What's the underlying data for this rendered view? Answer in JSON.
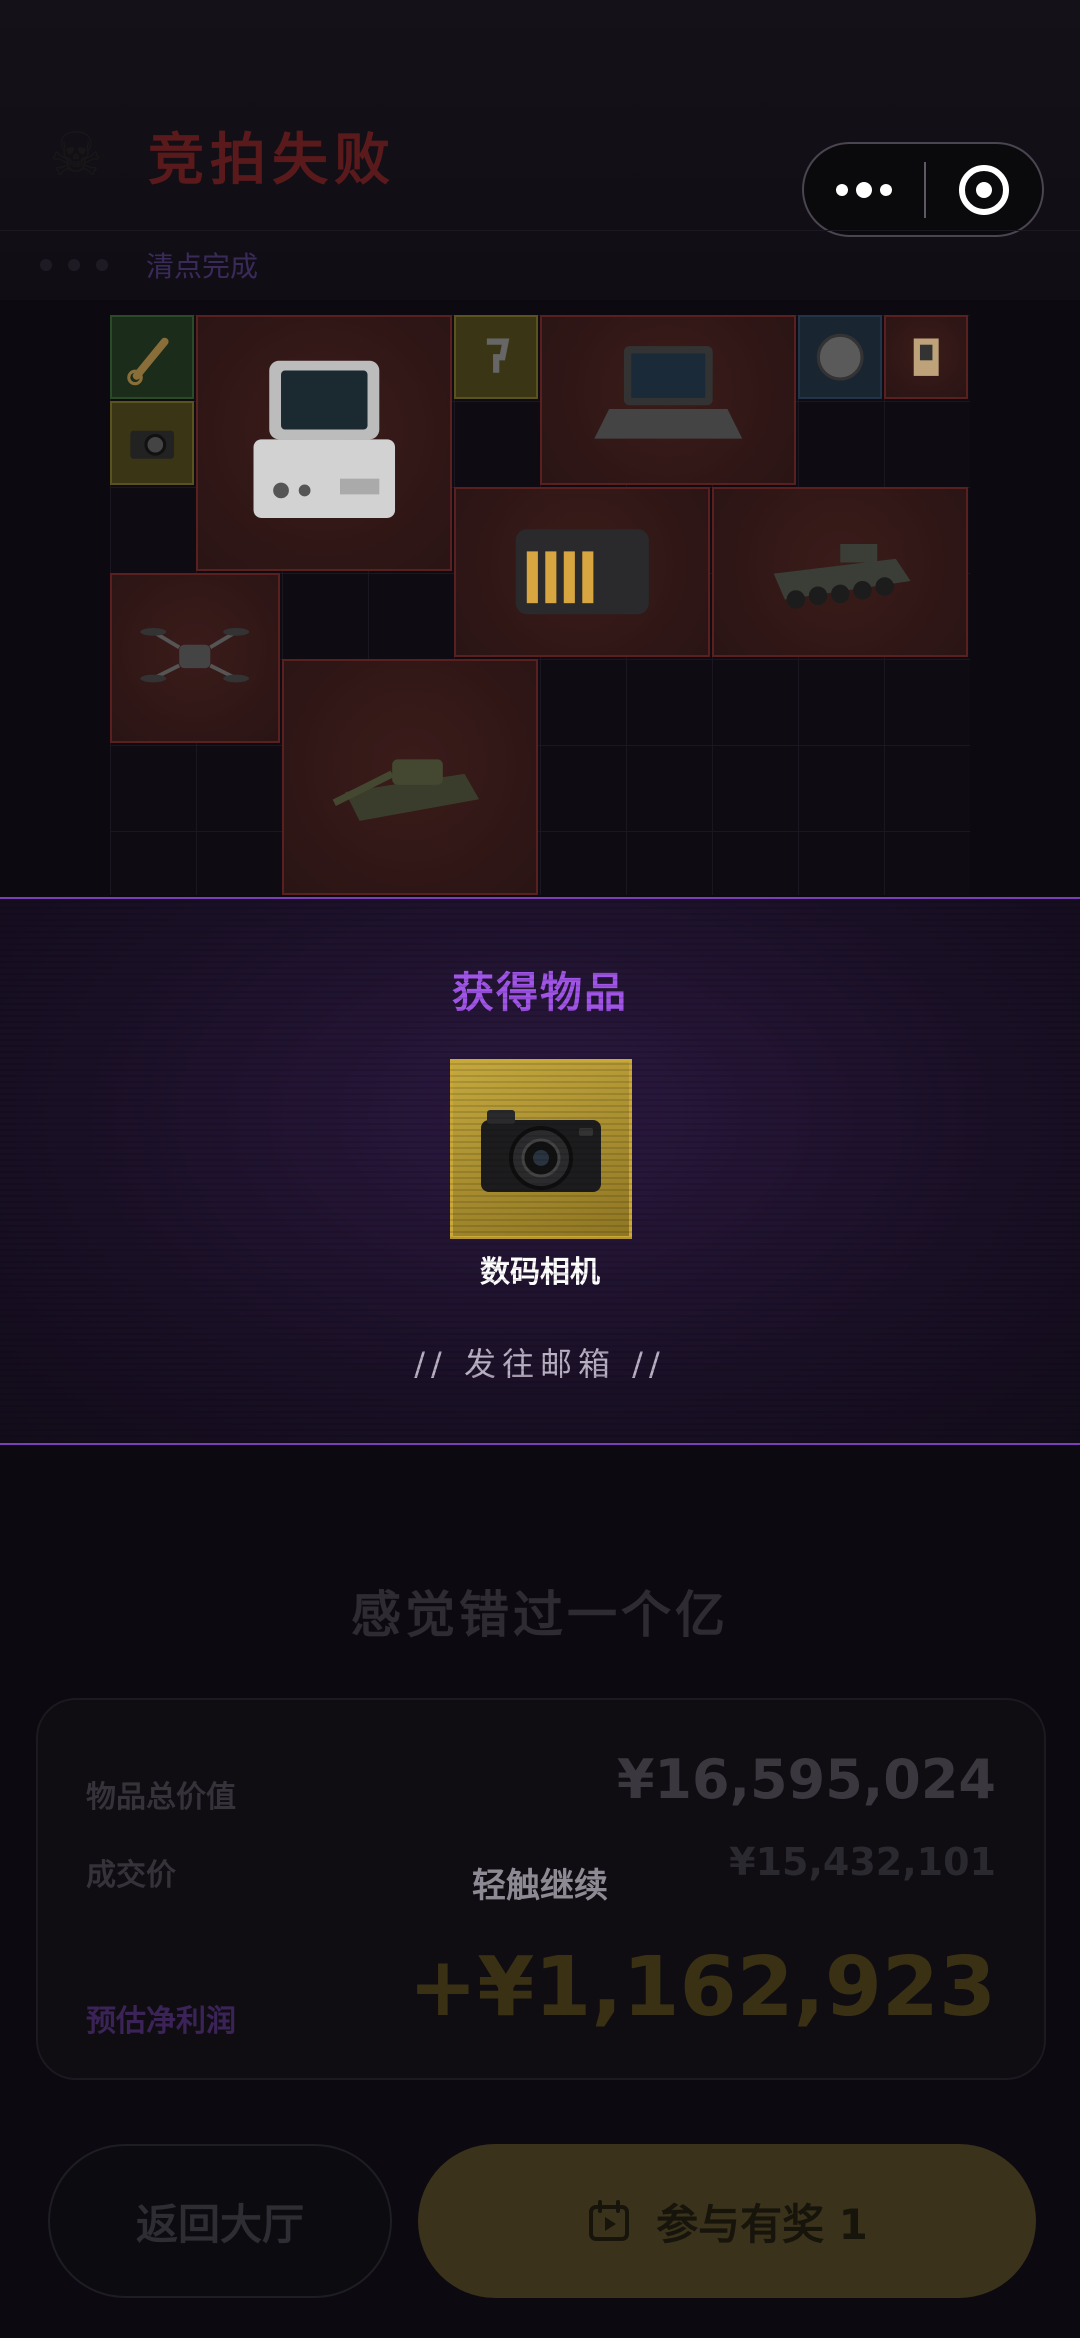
{
  "header": {
    "title": "竞拍失败",
    "status": "清点完成",
    "capsule": {
      "more_icon": "more-dots-icon",
      "close_icon": "target-icon"
    }
  },
  "grid": {
    "items": [
      {
        "name": "wrench",
        "color": "green",
        "icon": "wrench-icon"
      },
      {
        "name": "camera",
        "color": "yellow",
        "icon": "camera-icon"
      },
      {
        "name": "terminal",
        "color": "red",
        "icon": "terminal-device-icon"
      },
      {
        "name": "hook",
        "color": "yellow",
        "icon": "hook-icon"
      },
      {
        "name": "laptop",
        "color": "red",
        "icon": "laptop-icon"
      },
      {
        "name": "coin",
        "color": "blue",
        "icon": "coin-icon"
      },
      {
        "name": "module",
        "color": "red",
        "icon": "circuit-module-icon"
      },
      {
        "name": "server",
        "color": "red",
        "icon": "server-icon"
      },
      {
        "name": "apc",
        "color": "red",
        "icon": "armored-vehicle-icon"
      },
      {
        "name": "drone",
        "color": "red",
        "icon": "drone-icon"
      },
      {
        "name": "tank",
        "color": "red",
        "icon": "tank-icon"
      }
    ]
  },
  "reward": {
    "title": "获得物品",
    "item_name": "数码相机",
    "item_icon": "camera-icon",
    "delivery": "// 发往邮箱 //"
  },
  "summary": {
    "regret": "感觉错过一个亿",
    "total_label": "物品总价值",
    "total_value": "¥16,595,024",
    "deal_label": "成交价",
    "deal_value": "¥15,432,101",
    "profit_label": "预估净利润",
    "profit_value": "+¥1,162,923",
    "tap_hint": "轻触继续"
  },
  "buttons": {
    "lobby": "返回大厅",
    "prize": "参与有奖 1"
  }
}
